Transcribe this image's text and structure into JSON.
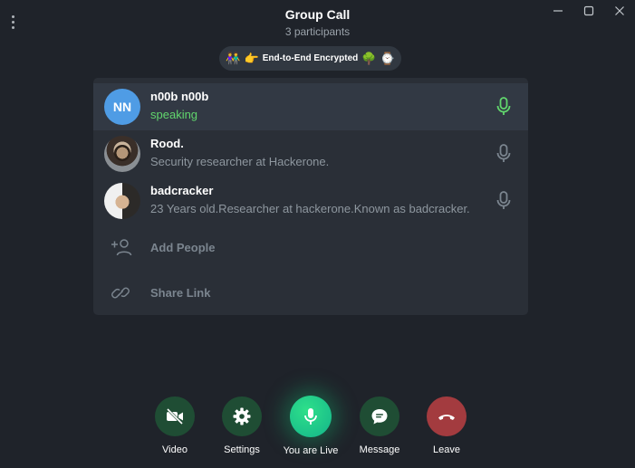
{
  "window": {
    "title": "Group Call",
    "subtitle": "3 participants"
  },
  "encryption_badge": {
    "emoji_left": "👫",
    "emoji_point": "👉",
    "label": "End-to-End Encrypted",
    "emoji_tree": "🌳",
    "emoji_watch": "⌚"
  },
  "participants": [
    {
      "initials": "NN",
      "name": "n00b n00b",
      "status": "speaking",
      "speaking": true
    },
    {
      "name": "Rood.",
      "status": "Security researcher at Hackerone."
    },
    {
      "name": "badcracker",
      "status": "23 Years old.Researcher at hackerone.Known as badcracker."
    }
  ],
  "actions": {
    "add_people": "Add People",
    "share_link": "Share Link"
  },
  "controls": {
    "video": "Video",
    "settings": "Settings",
    "live": "You are Live",
    "message": "Message",
    "leave": "Leave"
  },
  "colors": {
    "background": "#1f232a",
    "panel": "#2a2f37",
    "speaking_green": "#61d66d",
    "control_dark_green": "#1f4d34",
    "live_green": "#14b48a",
    "leave_red": "#a33b3f"
  }
}
